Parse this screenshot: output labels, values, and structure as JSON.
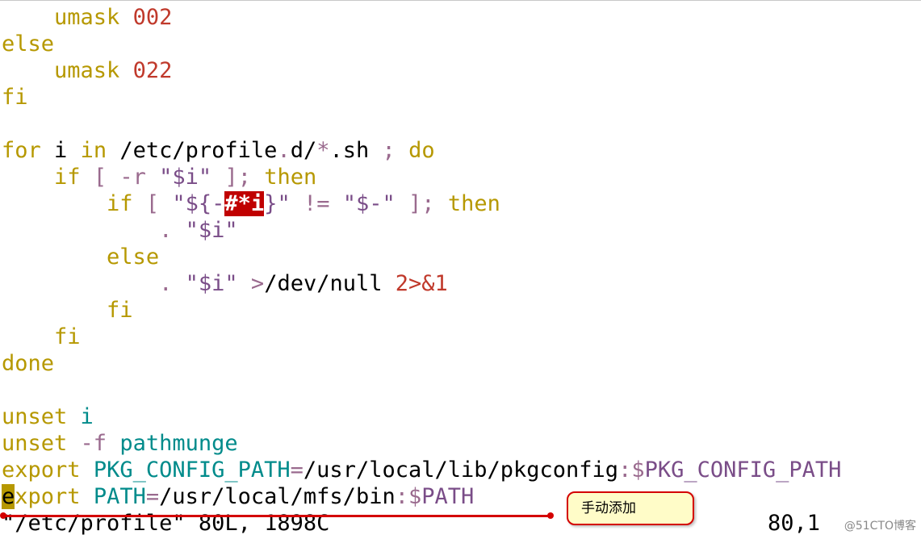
{
  "file": {
    "status_message": "\"/etc/profile\" 80L, 1898C",
    "cursor_position": "80,1"
  },
  "annotation": {
    "callout_text": "手动添加"
  },
  "watermark": "@51CTO博客",
  "code": {
    "l1": {
      "kw": "umask",
      "num": "002"
    },
    "l2": {
      "kw": "else"
    },
    "l3": {
      "kw": "umask",
      "num": "022"
    },
    "l4": {
      "kw": "fi"
    },
    "l6": {
      "for": "for",
      "i": "i",
      "in": "in",
      "path": "/etc/profile",
      "dot": ".",
      "d": "d/",
      "star": "*",
      "sh": ".sh",
      "semi": ";",
      "do": "do"
    },
    "l7": {
      "if": "if",
      "br": "[",
      "flag": "-r",
      "q1": "\"$",
      "var": "i",
      "q2": "\"",
      "close": "];",
      "then": "then"
    },
    "l8": {
      "if": "if",
      "br": "[",
      "q1": "\"${-",
      "hl": "#*i",
      "brace": "}",
      "q2": "\"",
      "ne": "!=",
      "q3": "\"$-\"",
      "close": "];",
      "then": "then"
    },
    "l9": {
      "dot": ".",
      "q1": "\"$",
      "var": "i",
      "q2": "\""
    },
    "l10": {
      "kw": "else"
    },
    "l11": {
      "dot": ".",
      "q1": "\"$",
      "var": "i",
      "q2": "\"",
      "gt": ">",
      "path": "/dev/null",
      "redir": "2>&1"
    },
    "l12": {
      "kw": "fi"
    },
    "l13": {
      "kw": "fi"
    },
    "l14": {
      "kw": "done"
    },
    "l16": {
      "kw": "unset",
      "var": "i"
    },
    "l17": {
      "kw": "unset",
      "flag": "-f",
      "var": "pathmunge"
    },
    "l18": {
      "kw": "export",
      "name": "PKG_CONFIG_PATH",
      "eq": "=",
      "path": "/usr/local/lib/pkgconfig",
      "colon": ":",
      "dollar": "$",
      "ref": "PKG_CONFIG_PATH"
    },
    "l19": {
      "cursor": "e",
      "kw": "xport",
      "name": "PATH",
      "eq": "=",
      "path": "/usr/local/mfs/bin",
      "colon": ":",
      "dollar": "$",
      "ref": "PATH"
    }
  }
}
